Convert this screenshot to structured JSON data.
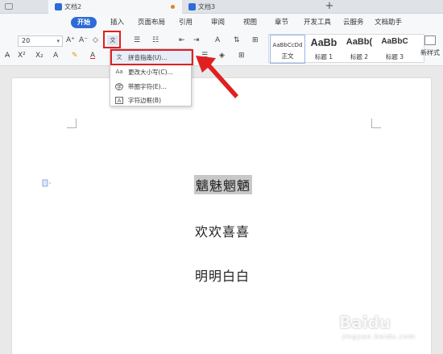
{
  "tabs": [
    {
      "label": "",
      "active": false
    },
    {
      "label": "文档2",
      "active": true,
      "icon": "doc-icon",
      "dot_color": "#e67e22"
    },
    {
      "label": "文档3",
      "active": false,
      "icon": "doc-icon",
      "dot_color": ""
    }
  ],
  "new_tab_label": "+",
  "menu": [
    "开始",
    "插入",
    "页面布局",
    "引用",
    "审阅",
    "视图",
    "章节",
    "开发工具",
    "云服务",
    "文档助手"
  ],
  "ribbon": {
    "font_size": "20",
    "styles": [
      {
        "preview": "AaBbCcDd",
        "name": "正文"
      },
      {
        "preview": "AaBb",
        "name": "标题 1"
      },
      {
        "preview": "AaBb(",
        "name": "标题 2"
      },
      {
        "preview": "AaBbC",
        "name": "标题 3"
      }
    ],
    "new_style": "新样式"
  },
  "dropdown": {
    "items": [
      {
        "icon": "pinyin-icon",
        "label": "拼音指南(U)..."
      },
      {
        "icon": "change-case-icon",
        "label": "更改大小写(C)..."
      },
      {
        "icon": "enclosed-char-icon",
        "label": "带圈字符(E)..."
      },
      {
        "icon": "char-border-icon",
        "label": "字符边框(B)"
      }
    ]
  },
  "document": {
    "lines": [
      "魑魅魍魉",
      "欢欢喜喜",
      "明明白白"
    ]
  },
  "watermark": {
    "main": "Baidu",
    "sub": "jingyan.baidu.com"
  },
  "colors": {
    "accent": "#2e6bd6",
    "highlight_red": "#e02020",
    "selection": "#c8c8c8"
  }
}
